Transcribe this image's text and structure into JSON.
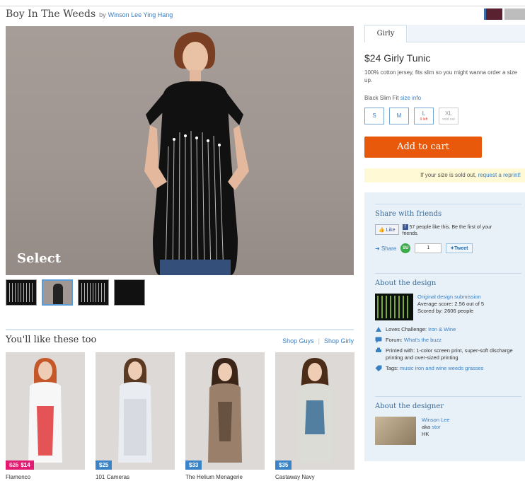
{
  "header": {
    "design_title": "Boy In The Weeds",
    "by": "by",
    "artist": "Winson Lee Ying Hang"
  },
  "gallery": {
    "watermark": "Select",
    "thumb_count": 4,
    "active_thumb": 2
  },
  "recommend": {
    "title": "You'll like these too",
    "shop_guys": "Shop Guys",
    "separator": "|",
    "shop_girly": "Shop Girly",
    "products": [
      {
        "name": "Flamenco",
        "old_price": "$25",
        "price": "$14",
        "sale": true,
        "shirt": "#f7f7f7",
        "accent": "#e0363a",
        "hair": "#c4582a"
      },
      {
        "name": "101 Cameras",
        "old_price": "",
        "price": "$25",
        "sale": false,
        "shirt": "#e9ecf0",
        "accent": "#c5cad1",
        "hair": "#5a3a22"
      },
      {
        "name": "The Helium Menagerie",
        "old_price": "",
        "price": "$33",
        "sale": false,
        "shirt": "#9a7f6b",
        "accent": "#5a4636",
        "hair": "#3a2518"
      },
      {
        "name": "Castaway Navy",
        "old_price": "",
        "price": "$35",
        "sale": false,
        "shirt": "#dcdcd6",
        "accent": "#3a6f95",
        "hair": "#4a2c18"
      }
    ]
  },
  "product": {
    "tab": "Girly",
    "title": "$24 Girly Tunic",
    "description": "100% cotton jersey, fits slim so you might wanna order a size up.",
    "fit": "Black Slim Fit",
    "size_info": "size info",
    "sizes": [
      {
        "label": "S",
        "note": ""
      },
      {
        "label": "M",
        "note": ""
      },
      {
        "label": "L",
        "note": "9 left"
      },
      {
        "label": "XL",
        "note": "sold out"
      }
    ],
    "add_to_cart": "Add to cart",
    "soldout_text": "If your size is sold out,",
    "reprint_link": "request a reprint!"
  },
  "share": {
    "title": "Share with friends",
    "like_label": "Like",
    "fb_text": "57 people like this. Be the first of your friends.",
    "share_label": "Share",
    "su_count": "1",
    "tweet_label": "Tweet"
  },
  "about_design": {
    "title": "About the design",
    "submission": "Original design submission",
    "score": "Average score: 2.56 out of 5",
    "scored_by": "Scored by: 2606 people",
    "challenge_label": "Loves Challenge:",
    "challenge_link": "Iron & Wine",
    "forum_label": "Forum:",
    "forum_link": "What's the buzz",
    "printed": "Printed with: 1-color screen print, super-soft discharge printing and over-sized printing",
    "tags_label": "Tags:",
    "tags_link": "music iron and wine weeds grasses"
  },
  "about_designer": {
    "title": "About the designer",
    "name": "Winson Lee",
    "aka": "aka",
    "handle": "stor",
    "location": "HK"
  },
  "colors": {
    "accent_link": "#3a7fc1",
    "cta": "#e8590c",
    "sale_badge": "#e21a72",
    "price_badge": "#3a83c6"
  }
}
